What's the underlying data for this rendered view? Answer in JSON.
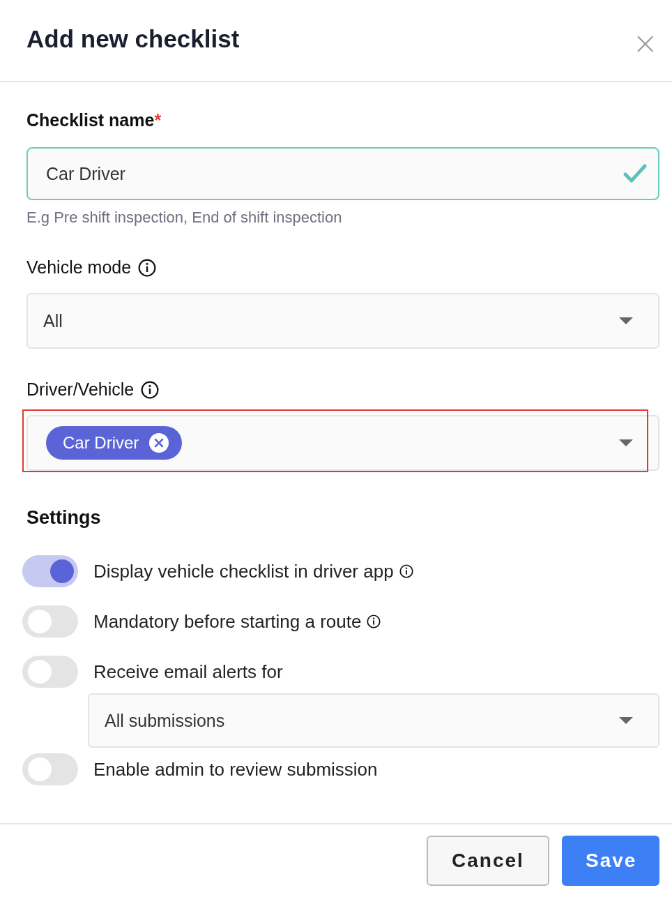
{
  "dialog": {
    "title": "Add new checklist",
    "close": "×"
  },
  "name_field": {
    "label": "Checklist name",
    "required_mark": "*",
    "value": "Car Driver",
    "valid": true,
    "hint": "E.g Pre shift inspection, End of shift inspection"
  },
  "vehicle_mode": {
    "label": "Vehicle mode",
    "value": "All"
  },
  "driver_vehicle": {
    "label": "Driver/Vehicle",
    "chips": [
      {
        "label": "Car Driver"
      }
    ],
    "highlighted": true
  },
  "settings": {
    "title": "Settings",
    "items": [
      {
        "label": "Display vehicle checklist in driver app",
        "on": true,
        "info": true
      },
      {
        "label": "Mandatory before starting a route",
        "on": false,
        "info": true
      },
      {
        "label": "Receive email alerts for",
        "on": false,
        "info": false,
        "select": "All submissions"
      },
      {
        "label": "Enable admin to review submission",
        "on": false,
        "info": false
      }
    ]
  },
  "buttons": [
    {
      "label": "Cancel",
      "kind": "secondary"
    },
    {
      "label": "Save",
      "kind": "primary"
    }
  ]
}
